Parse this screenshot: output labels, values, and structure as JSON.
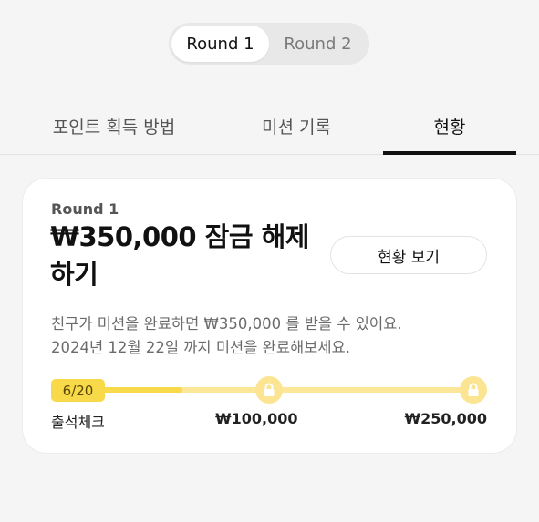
{
  "round_toggle": {
    "options": [
      "Round 1",
      "Round 2"
    ],
    "selected": "Round 1"
  },
  "tabs": [
    "포인트 획득 방법",
    "미션 기록",
    "현황"
  ],
  "active_tab": "현황",
  "card": {
    "round_label": "Round 1",
    "title": "₩350,000 잠금 해제하기",
    "status_button": "현황 보기",
    "description_line1": "친구가 미션을 완료하면 ₩350,000 를 받을 수 있어요.",
    "description_line2": "2024년 12월 22일 까지 미션을 완료해보세요.",
    "progress": {
      "badge": "6/20",
      "fill_fraction": 0.3,
      "start_label": "출석체크",
      "milestone_1": "₩100,000",
      "milestone_2": "₩250,000"
    }
  },
  "icons": {
    "milestone": "lock-icon"
  },
  "colors": {
    "accent_yellow": "#f7d94a",
    "track_yellow": "#fbe797",
    "background": "#f5f5f5"
  }
}
